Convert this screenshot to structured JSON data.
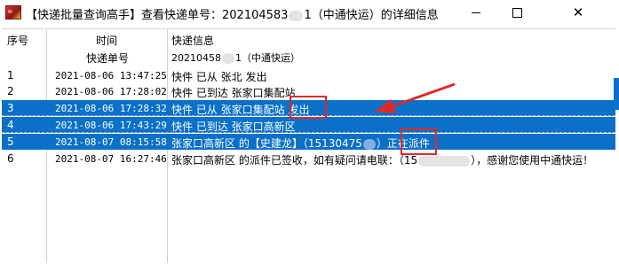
{
  "window": {
    "title_prefix": "【快递批量查询高手】查看快递单号：202104583",
    "title_suffix": "1（中通快运）的详细信息",
    "icon_name": "app-logo-icon"
  },
  "columns": {
    "no": "序号",
    "time": "时间",
    "info": "快递信息",
    "sub_label": "快递单号",
    "sub_value_prefix": "20210458",
    "sub_value_suffix": "1（中通快运）"
  },
  "rows": [
    {
      "no": "1",
      "time": "2021-08-06 13:47:25",
      "info": "快件 已从 张北 发出",
      "selected": false
    },
    {
      "no": "2",
      "time": "2021-08-06 17:28:02",
      "info": "快件 已到达 张家口集配站",
      "selected": false
    },
    {
      "no": "3",
      "time": "2021-08-06 17:28:32",
      "info": "快件 已从 张家口集配站 发出",
      "selected": true
    },
    {
      "no": "4",
      "time": "2021-08-06 17:43:29",
      "info": "快件 已到达 张家口高新区",
      "selected": true
    },
    {
      "no": "5",
      "time": "2021-08-07 08:15:58",
      "info_prefix": "张家口高新区 的【史建龙】（15130475",
      "info_suffix": "）正在派件",
      "selected": true
    },
    {
      "no": "6",
      "time": "2021-08-07 16:27:46",
      "info_prefix": "张家口高新区 的派件已签收，如有疑问请电联：（15",
      "info_suffix": "），感谢您使用中通快运！",
      "selected": false
    }
  ],
  "colors": {
    "selection": "#0a70c8",
    "highlight_box": "#e02828",
    "arrow": "#e02828"
  }
}
